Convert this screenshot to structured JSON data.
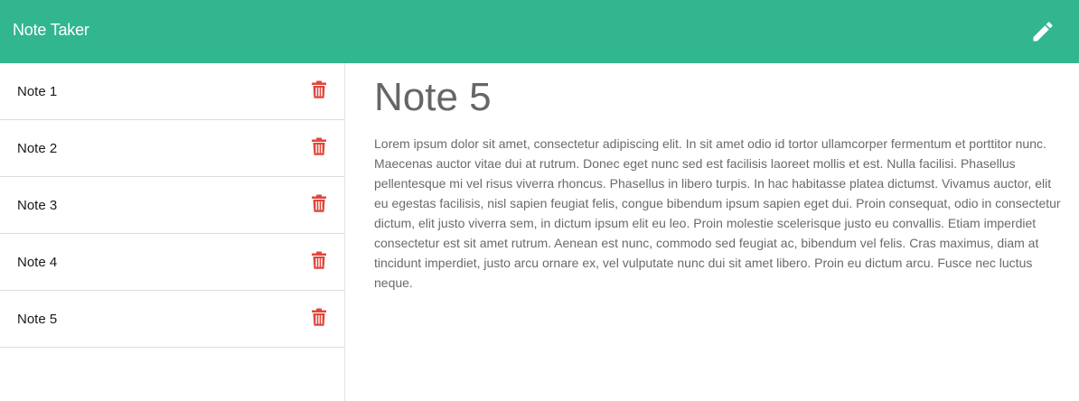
{
  "navbar": {
    "title": "Note Taker",
    "new_note_icon": "pencil-icon",
    "color": "#32b690"
  },
  "sidebar": {
    "notes": [
      {
        "title": "Note 1",
        "icon": "trash-icon"
      },
      {
        "title": "Note 2",
        "icon": "trash-icon"
      },
      {
        "title": "Note 3",
        "icon": "trash-icon"
      },
      {
        "title": "Note 4",
        "icon": "trash-icon"
      },
      {
        "title": "Note 5",
        "icon": "trash-icon"
      }
    ],
    "delete_color": "#e0463b"
  },
  "main": {
    "title": "Note 5",
    "body": "Lorem ipsum dolor sit amet, consectetur adipiscing elit. In sit amet odio id tortor ullamcorper fermentum et porttitor nunc. Maecenas auctor vitae dui at rutrum. Donec eget nunc sed est facilisis laoreet mollis et est. Nulla facilisi. Phasellus pellentesque mi vel risus viverra rhoncus. Phasellus in libero turpis. In hac habitasse platea dictumst. Vivamus auctor, elit eu egestas facilisis, nisl sapien feugiat felis, congue bibendum ipsum sapien eget dui. Proin consequat, odio in consectetur dictum, elit justo viverra sem, in dictum ipsum elit eu leo. Proin molestie scelerisque justo eu convallis. Etiam imperdiet consectetur est sit amet rutrum. Aenean est nunc, commodo sed feugiat ac, bibendum vel felis. Cras maximus, diam at tincidunt imperdiet, justo arcu ornare ex, vel vulputate nunc dui sit amet libero. Proin eu dictum arcu. Fusce nec luctus neque."
  }
}
